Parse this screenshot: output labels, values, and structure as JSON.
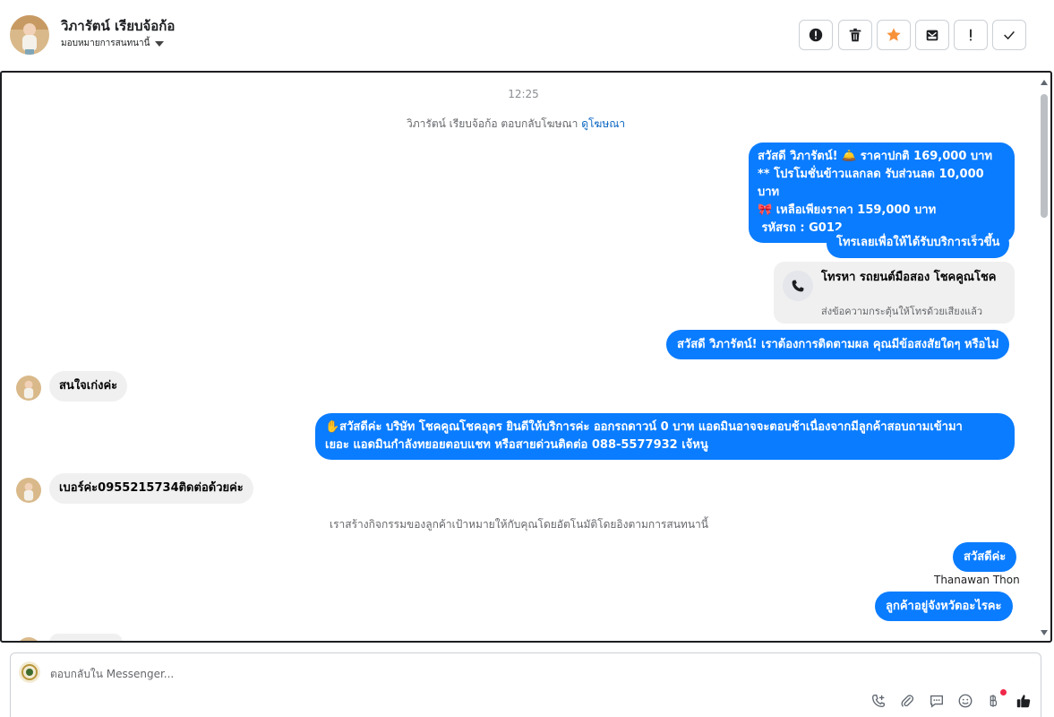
{
  "header": {
    "contact_name": "วิภารัตน์ เรียบจ้อก้อ",
    "assign_label": "มอบหมายการสนทนานี้",
    "tools": [
      {
        "name": "report-spam-icon"
      },
      {
        "name": "trash-icon"
      },
      {
        "name": "star-icon",
        "color": "#f7923a"
      },
      {
        "name": "mark-unread-icon"
      },
      {
        "name": "follow-up-icon"
      },
      {
        "name": "done-check-icon"
      }
    ]
  },
  "conversation": {
    "timestamp": "12:25",
    "ad_reply_text": "วิภารัตน์ เรียบจ้อก้อ ตอบกลับโฆษณา",
    "ad_reply_link": "ดูโฆษณา",
    "msg1": {
      "line1": "สวัสดี วิภารัตน์! 🛎️ ราคาปกติ 169,000 บาท",
      "line2": "** โปรโมชั่นข้าวแลกลด รับส่วนลด 10,000 บาท",
      "line3": "🎀  เหลือเพียงราคา 159,000 บาท",
      "line4": " รหัสรถ : G012"
    },
    "msg2": "โทรเลยเพื่อให้ได้รับบริการเร็วขึ้น",
    "call_card": {
      "title": "โทรหา รถยนต์มือสอง โชคคูณโชค",
      "subtitle": "ส่งข้อความกระตุ้นให้โทรด้วยเสียงแล้ว"
    },
    "msg3": "สวัสดี วิภารัตน์! เราต้องการติดตามผล คุณมีข้อสงสัยใดๆ หรือไม่",
    "in1": "สนใจเก่งค่ะ",
    "msg4": {
      "line1": "✋สวัสดีค่ะ บริษัท โชคคูณโชคอุดร ยินดีให้บริการค่ะ ออกรถดาวน์ 0 บาท แอดมินอาจจะตอบช้าเนื่องจากมีลูกค้าสอบถามเข้ามา",
      "line2": "เยอะ แอดมินกำลังทยอยตอบแชท หรือสายด่วนติดต่อ 088-5577932 เจ้หนู"
    },
    "in2": "เบอร์ค่ะ0955215734ติดต่อด้วยค่ะ",
    "system_note": "เราสร้างกิจกรรมของลูกค้าเป้าหมายให้กับคุณโดยอัตโนมัติโดยอิงตามการสนทนานี้",
    "msg5": "สวัสดีค่ะ",
    "sender_name": "Thanawan Thon",
    "msg6": "ลูกค้าอยู่จังหวัดอะไรคะ"
  },
  "composer": {
    "placeholder": "ตอบกลับใน Messenger...",
    "icons": [
      "phone-plus-icon",
      "attach-icon",
      "saved-reply-icon",
      "emoji-icon",
      "baht-payment-icon",
      "like-icon"
    ]
  }
}
